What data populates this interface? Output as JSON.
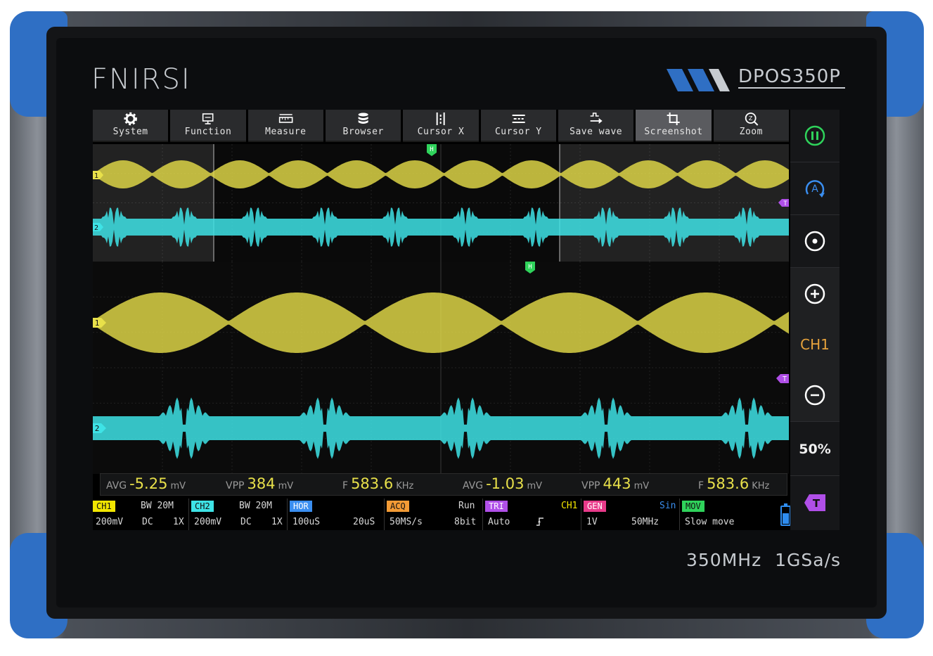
{
  "brand": "FNIRSI",
  "model": "DPOS350P",
  "spec_label": "350MHz  1GSa/s",
  "colors": {
    "ch1": "#e8e04a",
    "ch2": "#3ee3e6",
    "accent_blue": "#2f6fc4",
    "trigger": "#b04fe8",
    "marker_green": "#2fd35b"
  },
  "toolbar": [
    {
      "label": "System",
      "icon": "gear-icon"
    },
    {
      "label": "Function",
      "icon": "monitor-icon"
    },
    {
      "label": "Measure",
      "icon": "ruler-icon"
    },
    {
      "label": "Browser",
      "icon": "database-icon"
    },
    {
      "label": "Cursor X",
      "icon": "cursor-x-icon"
    },
    {
      "label": "Cursor Y",
      "icon": "cursor-y-icon"
    },
    {
      "label": "Save wave",
      "icon": "save-wave-icon"
    },
    {
      "label": "Screenshot",
      "icon": "crop-icon",
      "active": true
    },
    {
      "label": "Zoom",
      "icon": "zoom-icon"
    }
  ],
  "side_panel": {
    "run_icon": "pause-icon",
    "auto_icon": "auto-icon",
    "center_icon": "target-icon",
    "zoom_in_icon": "plus-icon",
    "channel": "CH1",
    "zoom_out_icon": "minus-icon",
    "fifty": "50%",
    "trigger_icon": "trigger-icon",
    "trigger_label": "T"
  },
  "markers": {
    "ch1": "1",
    "ch2": "2",
    "trigger": "T",
    "h": "H"
  },
  "measurements": [
    {
      "label": "AVG",
      "value": "-5.25",
      "unit": "mV"
    },
    {
      "label": "VPP",
      "value": "384",
      "unit": "mV"
    },
    {
      "label": "F",
      "value": "583.6",
      "unit": "KHz"
    },
    {
      "label": "AVG",
      "value": "-1.03",
      "unit": "mV"
    },
    {
      "label": "VPP",
      "value": "443",
      "unit": "mV"
    },
    {
      "label": "F",
      "value": "583.6",
      "unit": "KHz"
    }
  ],
  "status": {
    "ch1": {
      "tag": "CH1",
      "bw": "BW 20M",
      "volts": "200mV",
      "coupling": "DC",
      "probe": "1X",
      "color": "#f2e600"
    },
    "ch2": {
      "tag": "CH2",
      "bw": "BW 20M",
      "volts": "200mV",
      "coupling": "DC",
      "probe": "1X",
      "color": "#3ee3e6"
    },
    "hor": {
      "tag": "HOR",
      "time": "100uS",
      "offset": "20uS",
      "color": "#3a8ef0"
    },
    "acq": {
      "tag": "ACQ",
      "mode": "Run",
      "rate": "50MS/s",
      "bits": "8bit",
      "color": "#f39b35"
    },
    "tri": {
      "tag": "TRI",
      "source": "CH1",
      "mode": "Auto",
      "edge": "rising-edge-icon",
      "color": "#b04fe8"
    },
    "gen": {
      "tag": "GEN",
      "wave": "Sin",
      "amp": "1V",
      "freq": "50MHz",
      "color": "#e83a8a"
    },
    "mov": {
      "tag": "MOV",
      "mode": "Slow move",
      "color": "#2fd35b"
    },
    "battery": "battery-icon"
  }
}
